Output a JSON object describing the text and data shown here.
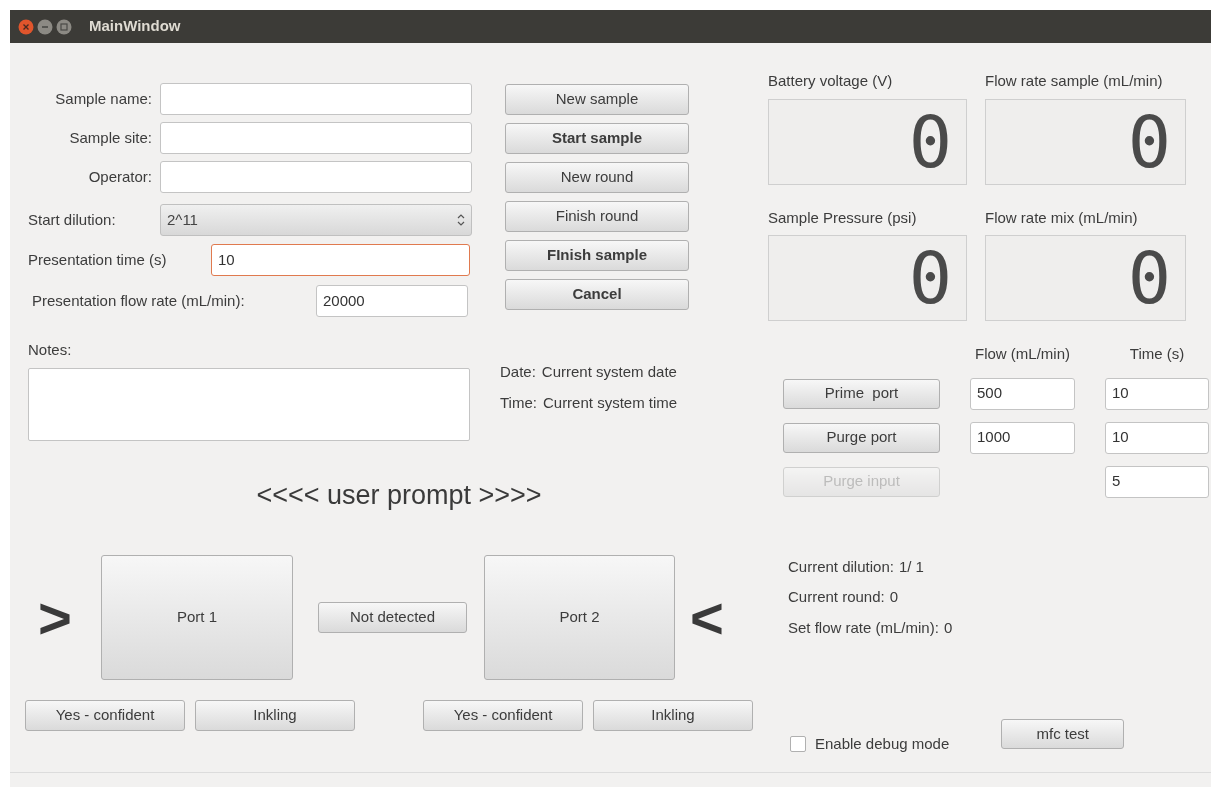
{
  "window": {
    "title": "MainWindow"
  },
  "sample_form": {
    "fields": [
      {
        "label": "Sample name:"
      },
      {
        "label": "Sample site:"
      },
      {
        "label": "Operator:"
      }
    ],
    "start_dilution": {
      "label": "Start dilution:",
      "value": "2^11"
    },
    "presentation_time": {
      "label": "Presentation time (s)",
      "value": "10",
      "focused": true
    },
    "presentation_flow_rate": {
      "label": "Presentation flow rate (mL/min):",
      "value": "20000",
      "focused": false
    }
  },
  "actions": [
    {
      "label": "New sample",
      "emphasized": false
    },
    {
      "label": "Start sample",
      "emphasized": true
    },
    {
      "label": "New round",
      "emphasized": false
    },
    {
      "label": "Finish round",
      "emphasized": false
    },
    {
      "label": "FInish sample",
      "emphasized": true
    },
    {
      "label": "Cancel",
      "emphasized": true
    }
  ],
  "displays": [
    {
      "label": "Battery voltage (V)",
      "reading": "0"
    },
    {
      "label": "Flow rate sample (mL/min)",
      "reading": "0"
    },
    {
      "label": "Sample Pressure (psi)",
      "reading": "0"
    },
    {
      "label": "Flow rate mix (mL/min)",
      "reading": "0"
    }
  ],
  "notes": {
    "label": "Notes:"
  },
  "date_time": [
    {
      "label": "Date:",
      "value": "Current system date"
    },
    {
      "label": "Time:",
      "value": "Current system time"
    }
  ],
  "port_control": {
    "columns": [
      "Flow (mL/min)",
      "Time (s)"
    ],
    "rows": [
      {
        "button": "Prime  port",
        "disabled": false,
        "flow": "500",
        "time": "10"
      },
      {
        "button": "Purge port",
        "disabled": false,
        "flow": "1000",
        "time": "10"
      },
      {
        "button": "Purge input",
        "disabled": true,
        "time": "5"
      }
    ]
  },
  "prompt": "<<<< user prompt >>>>",
  "ports": {
    "left_marker": ">",
    "buttons": [
      "Port 1",
      "Port 2"
    ],
    "status": "Not detected",
    "right_marker": "<"
  },
  "answer_groups": [
    {
      "buttons": [
        "Yes - confident",
        "Inkling"
      ]
    },
    {
      "buttons": [
        "Yes - confident",
        "Inkling"
      ]
    }
  ],
  "status_info": [
    {
      "label": "Current dilution:",
      "value": "1/ 1"
    },
    {
      "label": "Current round:",
      "value": "0"
    },
    {
      "label": "Set flow rate (mL/min):",
      "value": "0"
    }
  ],
  "debug": {
    "label": "Enable debug mode",
    "checked": false
  },
  "test_button": "mfc test"
}
